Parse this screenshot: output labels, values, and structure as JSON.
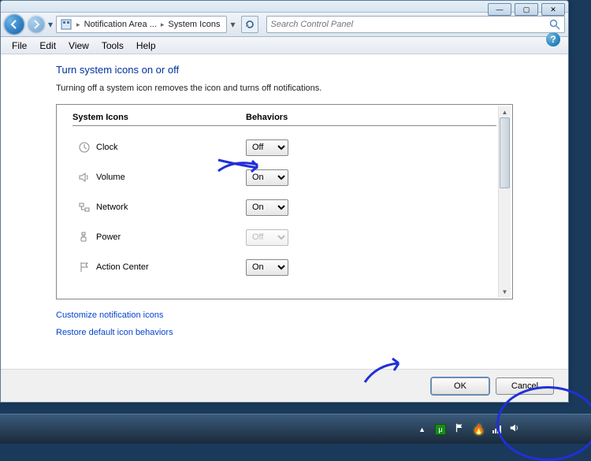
{
  "window_controls": {
    "min": "—",
    "max": "▢",
    "close": "✕"
  },
  "breadcrumb": {
    "part1": "Notification Area ...",
    "part2": "System Icons"
  },
  "search": {
    "placeholder": "Search Control Panel"
  },
  "menu": {
    "file": "File",
    "edit": "Edit",
    "view": "View",
    "tools": "Tools",
    "help": "Help"
  },
  "page": {
    "title": "Turn system icons on or off",
    "desc": "Turning off a system icon removes the icon and turns off notifications."
  },
  "columns": {
    "icons": "System Icons",
    "behaviors": "Behaviors"
  },
  "options": {
    "on": "On",
    "off": "Off"
  },
  "rows": [
    {
      "icon": "clock-icon",
      "label": "Clock",
      "value": "Off",
      "enabled": true
    },
    {
      "icon": "volume-icon",
      "label": "Volume",
      "value": "On",
      "enabled": true
    },
    {
      "icon": "network-icon",
      "label": "Network",
      "value": "On",
      "enabled": true
    },
    {
      "icon": "power-icon",
      "label": "Power",
      "value": "Off",
      "enabled": false
    },
    {
      "icon": "flag-icon",
      "label": "Action Center",
      "value": "On",
      "enabled": true
    }
  ],
  "links": {
    "customize": "Customize notification icons",
    "restore": "Restore default icon behaviors"
  },
  "buttons": {
    "ok": "OK",
    "cancel": "Cancel"
  },
  "tray": {
    "u": "μ"
  }
}
